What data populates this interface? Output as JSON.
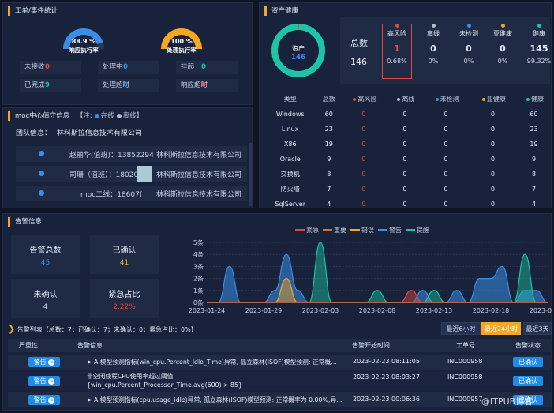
{
  "workorder": {
    "title": "工单/事件统计",
    "gauges": [
      {
        "value": "88.9 %",
        "label": "响应执行率",
        "percent": 0.889,
        "color": "#3a8ee6"
      },
      {
        "value": "100 %",
        "label": "处理执行率",
        "percent": 1.0,
        "color": "#f5a623"
      }
    ],
    "cells": [
      {
        "label": "未接收",
        "value": "0",
        "color": "#e04848"
      },
      {
        "label": "处理中",
        "value": "0",
        "color": "#3a8ee6"
      },
      {
        "label": "挂起",
        "value": "0",
        "color": "#1ec4a6"
      },
      {
        "label": "已完成",
        "value": "9",
        "color": "#1ec4a6"
      },
      {
        "label": "处理超时",
        "value": "0",
        "color": "#3a8ee6"
      },
      {
        "label": "响应超时",
        "value": "0",
        "color": "#e04848"
      }
    ]
  },
  "moc": {
    "title": "moc中心值守信息",
    "note_prefix": "【注:",
    "online": "在线",
    "offline": "离线",
    "note_suffix": "】",
    "team_label": "团队信息：",
    "team_name": "林科斯拉信息技术有限公司",
    "rows": [
      {
        "name": "赵丽华(值班)：13852294",
        "company": "林科斯拉信息技术有限公司"
      },
      {
        "name": "司珊（值班）：18020137",
        "company": "林科斯拉信息技术有限公司"
      },
      {
        "name": "moc二线：18607(",
        "company": "林科斯拉信息技术有限公司"
      }
    ]
  },
  "asset": {
    "title": "资产健康",
    "donut_label": "资产",
    "donut_value": "146",
    "total_label": "总数",
    "total_value": "146",
    "stats": [
      {
        "label": "高风险",
        "value": "1",
        "pct": "0.68%",
        "color": "#e04848"
      },
      {
        "label": "离线",
        "value": "0",
        "pct": "0%",
        "color": "#b5bdc9"
      },
      {
        "label": "未检测",
        "value": "0",
        "pct": "0%",
        "color": "#3a8ee6"
      },
      {
        "label": "亚健康",
        "value": "0",
        "pct": "0%",
        "color": "#f5a623"
      },
      {
        "label": "健康",
        "value": "145",
        "pct": "99.32%",
        "color": "#1ec4a6"
      }
    ],
    "table_headers": [
      "类型",
      "总数",
      "高风险",
      "离线",
      "未检测",
      "亚健康",
      "健康"
    ],
    "table_rows": [
      [
        "Windows",
        "60",
        "0",
        "0",
        "0",
        "0",
        "60"
      ],
      [
        "Linux",
        "23",
        "0",
        "0",
        "0",
        "0",
        "23"
      ],
      [
        "X86",
        "19",
        "0",
        "0",
        "0",
        "0",
        "19"
      ],
      [
        "Oracle",
        "9",
        "0",
        "0",
        "0",
        "0",
        "9"
      ],
      [
        "交换机",
        "8",
        "0",
        "0",
        "0",
        "0",
        "8"
      ],
      [
        "防火墙",
        "7",
        "0",
        "0",
        "0",
        "0",
        "7"
      ],
      [
        "SqlServer",
        "4",
        "0",
        "0",
        "0",
        "0",
        "4"
      ]
    ]
  },
  "alarm": {
    "title": "告警信息",
    "boxes": [
      {
        "label": "告警总数",
        "value": "45",
        "color": "#3a8ee6"
      },
      {
        "label": "已确认",
        "value": "41",
        "color": "#f5a623"
      },
      {
        "label": "未确认",
        "value": "4",
        "color": "#c9d3e6"
      },
      {
        "label": "紧急占比",
        "value": "2.22%",
        "color": "#e04848"
      }
    ],
    "list_title": "告警列表【总数：7；已确认：7；未确认：0；紧急占比：0%】",
    "tabs": [
      "最近6小时",
      "最近24小时",
      "最近3天"
    ],
    "active_tab": 1,
    "headers": [
      "严重性",
      "告警信息",
      "告警开始时间",
      "工单号",
      "告警状态"
    ],
    "rows": [
      {
        "severity": "警告",
        "message": "➤ AI模型预测指标(win_cpu.Percent_Idle_Time)异常, 孤立森林(ISOF)模型预测: 正常概...",
        "time": "2023-02-23 08:11:05",
        "ticket": "INC000958",
        "status": "已确认"
      },
      {
        "severity": "警告",
        "message": "非空闲线程CPU使用率超过阈值\n{win_cpu.Percent_Processor_Time.avg(600) > 85}",
        "time": "2023-02-23 08:03:27",
        "ticket": "INC000958",
        "status": "已确认"
      },
      {
        "severity": "警告",
        "message": "➤ AI模型预测指标(cpu.usage_idle)异常, 孤立森林(ISOF)模型预测: 正常概率为 0.00%,异...",
        "time": "2023-02-23 00:06:36",
        "ticket": "INC000957",
        "status": "已确认"
      }
    ]
  },
  "chart_data": {
    "type": "area",
    "title": "",
    "xlabel": "",
    "ylabel": "",
    "ylim": [
      0,
      5
    ],
    "yticks": [
      "0条",
      "1条",
      "2条",
      "3条",
      "4条",
      "5条"
    ],
    "xticks": [
      "2023-01-24",
      "2023-01-29",
      "2023-02-03",
      "2023-02-08",
      "2023-02-13",
      "2023-02-18",
      "2023-02-23"
    ],
    "legend_position": "top",
    "x": [
      "01-24",
      "01-25",
      "01-26",
      "01-27",
      "01-28",
      "01-29",
      "01-30",
      "01-31",
      "02-01",
      "02-02",
      "02-03",
      "02-04",
      "02-05",
      "02-06",
      "02-07",
      "02-08",
      "02-09",
      "02-10",
      "02-11",
      "02-12",
      "02-13",
      "02-14",
      "02-15",
      "02-16",
      "02-17",
      "02-18",
      "02-19",
      "02-20",
      "02-21",
      "02-22",
      "02-23"
    ],
    "series": [
      {
        "name": "紧急",
        "color": "#e04848",
        "values": [
          0,
          0,
          0,
          0,
          0,
          0,
          0,
          0,
          0,
          0,
          0,
          0,
          0,
          0,
          0,
          0,
          0,
          0,
          1,
          0,
          0,
          0,
          0,
          0,
          0,
          0,
          0,
          0,
          0,
          0,
          0
        ]
      },
      {
        "name": "重要",
        "color": "#e0684a",
        "values": [
          0,
          0,
          0,
          0,
          0,
          0,
          0,
          0,
          0,
          0,
          0,
          0,
          0,
          0,
          0,
          0,
          0,
          0,
          0,
          0,
          0,
          0,
          0,
          0,
          0,
          0,
          0,
          0,
          0,
          0,
          0
        ]
      },
      {
        "name": "错误",
        "color": "#f5a623",
        "values": [
          0,
          0,
          0,
          0,
          0,
          0,
          0,
          2,
          0,
          0,
          0,
          0,
          0,
          0,
          0,
          0,
          0,
          0,
          0,
          0,
          0,
          0,
          0,
          0,
          0,
          0,
          0,
          0,
          0,
          0,
          0
        ]
      },
      {
        "name": "警告",
        "color": "#3a8ee6",
        "values": [
          0,
          0,
          3,
          0,
          0,
          0,
          1,
          4,
          1,
          0,
          0,
          0,
          0,
          0,
          0,
          0,
          0,
          0,
          0,
          1,
          0,
          0,
          1,
          0,
          2,
          2,
          3,
          0,
          1,
          1,
          0
        ]
      },
      {
        "name": "提醒",
        "color": "#1ec4a6",
        "values": [
          0,
          0,
          0,
          0,
          0,
          0,
          0,
          0,
          0,
          0,
          5,
          0,
          0,
          0,
          0,
          1,
          0,
          0,
          0,
          0,
          1,
          0,
          0,
          0,
          0,
          0,
          0,
          0,
          4,
          0,
          0
        ]
      }
    ]
  }
}
